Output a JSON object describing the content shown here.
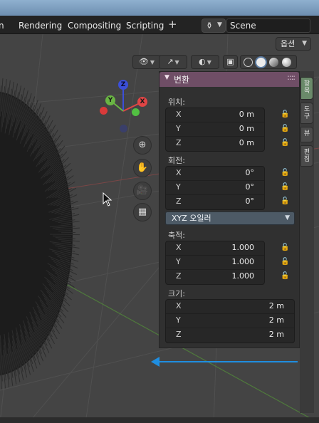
{
  "workspace_tabs": [
    {
      "label": "n"
    },
    {
      "label": "Rendering"
    },
    {
      "label": "Compositing"
    },
    {
      "label": "Scripting"
    }
  ],
  "add_workspace_label": "+",
  "scene": {
    "type_icon": "scene-icon",
    "name": "Scene"
  },
  "viewport": {
    "options_label": "옵션",
    "gizmo": {
      "x_label": "X",
      "y_label": "Y",
      "z_label": "Z"
    },
    "colors": {
      "x_axis": "#e04545",
      "y_axis": "#69b543",
      "z_axis": "#3b4fd9",
      "arrow": "#1f8ee0"
    }
  },
  "npanel": {
    "title": "변환",
    "location": {
      "label": "위치:",
      "rows": [
        {
          "axis": "X",
          "value": "0 m"
        },
        {
          "axis": "Y",
          "value": "0 m"
        },
        {
          "axis": "Z",
          "value": "0 m"
        }
      ]
    },
    "rotation": {
      "label": "회전:",
      "rows": [
        {
          "axis": "X",
          "value": "0°"
        },
        {
          "axis": "Y",
          "value": "0°"
        },
        {
          "axis": "Z",
          "value": "0°"
        }
      ]
    },
    "rotation_mode": "XYZ 오일러",
    "scale": {
      "label": "축적:",
      "rows": [
        {
          "axis": "X",
          "value": "1.000"
        },
        {
          "axis": "Y",
          "value": "1.000"
        },
        {
          "axis": "Z",
          "value": "1.000"
        }
      ]
    },
    "dimensions": {
      "label": "크기:",
      "rows": [
        {
          "axis": "X",
          "value": "2 m"
        },
        {
          "axis": "Y",
          "value": "2 m"
        },
        {
          "axis": "Z",
          "value": "2 m"
        }
      ]
    }
  },
  "sidebar_tabs": [
    "항목",
    "도구",
    "뷰",
    "편집"
  ]
}
